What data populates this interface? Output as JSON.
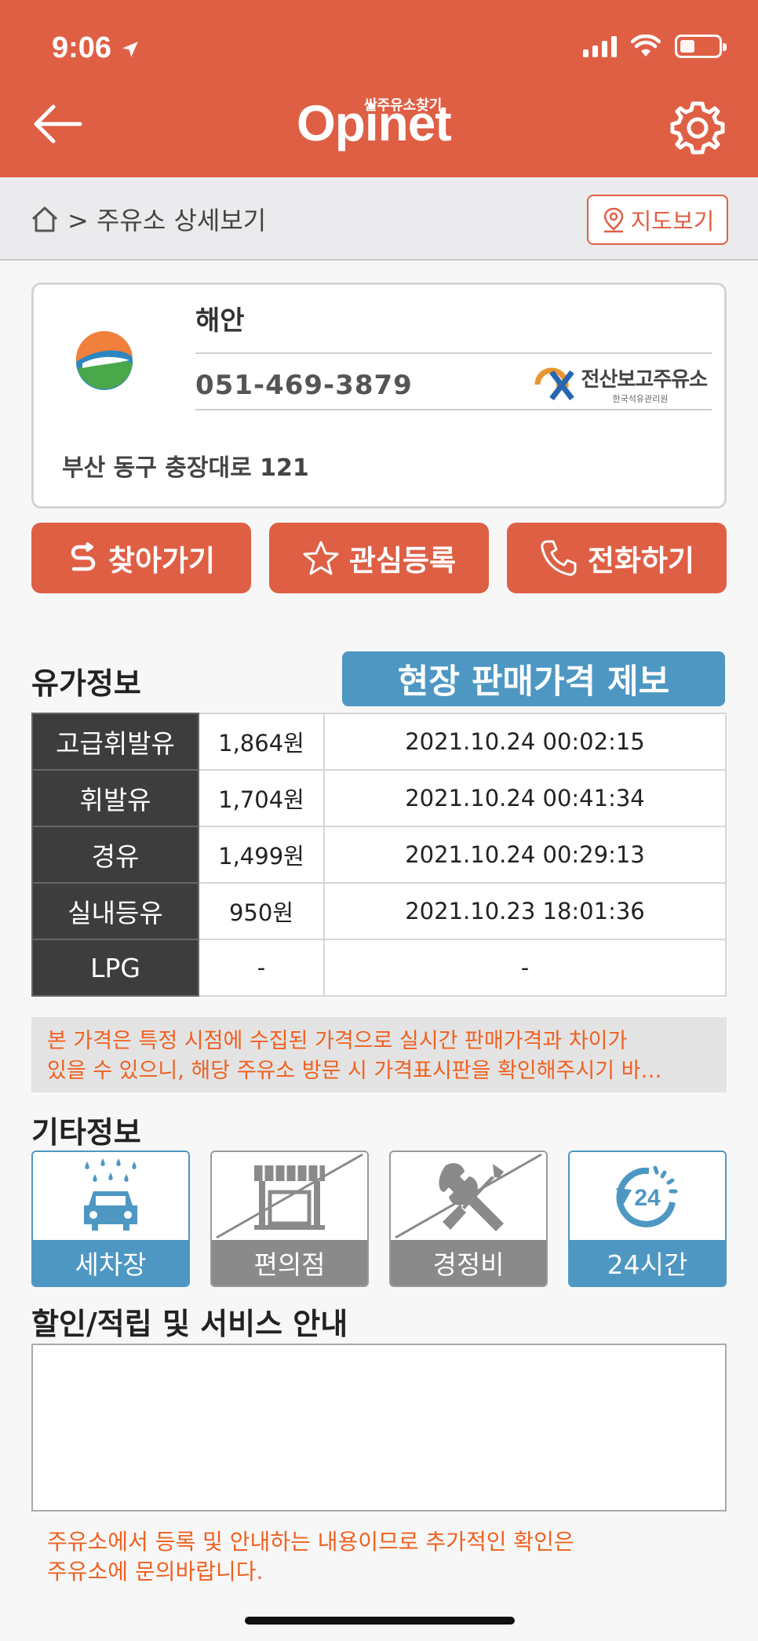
{
  "status_bar": {
    "time": "9:06"
  },
  "header": {
    "logo_main": "Opinet",
    "logo_sub": "싼주유소찾기"
  },
  "breadcrumb": {
    "text": "> 주유소 상세보기",
    "map_button": "지도보기"
  },
  "station": {
    "name": "해안",
    "phone": "051-469-3879",
    "address": "부산 동구 충장대로 121",
    "cert_title": "전산보고주유소",
    "cert_sub": "한국석유관리원"
  },
  "actions": {
    "navigate": "찾아가기",
    "favorite": "관심등록",
    "call": "전화하기"
  },
  "price_section": {
    "title": "유가정보",
    "report_button": "현장 판매가격 제보",
    "rows": [
      {
        "fuel": "고급휘발유",
        "price": "1,864원",
        "updated": "2021.10.24 00:02:15"
      },
      {
        "fuel": "휘발유",
        "price": "1,704원",
        "updated": "2021.10.24 00:41:34"
      },
      {
        "fuel": "경유",
        "price": "1,499원",
        "updated": "2021.10.24 00:29:13"
      },
      {
        "fuel": "실내등유",
        "price": "950원",
        "updated": "2021.10.23 18:01:36"
      },
      {
        "fuel": "LPG",
        "price": "-",
        "updated": "-"
      }
    ],
    "notice_line1": "본 가격은 특정 시점에 수집된 가격으로 실시간 판매가격과 차이가",
    "notice_line2": "있을 수 있으니, 해당 주유소 방문 시 가격표시판을 확인해주시기 바…"
  },
  "other_info": {
    "title": "기타정보",
    "facilities": [
      {
        "label": "세차장",
        "available": true
      },
      {
        "label": "편의점",
        "available": false
      },
      {
        "label": "경정비",
        "available": false
      },
      {
        "label": "24시간",
        "available": true
      }
    ]
  },
  "service": {
    "title": "할인/적립 및 서비스 안내",
    "content": "",
    "note_line1": "주유소에서 등록 및 안내하는 내용이므로 추가적인 확인은",
    "note_line2": "주유소에 문의바랍니다."
  },
  "colors": {
    "primary": "#df5f45",
    "accent_blue": "#4e97c3",
    "notice_text": "#f06020",
    "table_dark": "#3d3d3d"
  }
}
